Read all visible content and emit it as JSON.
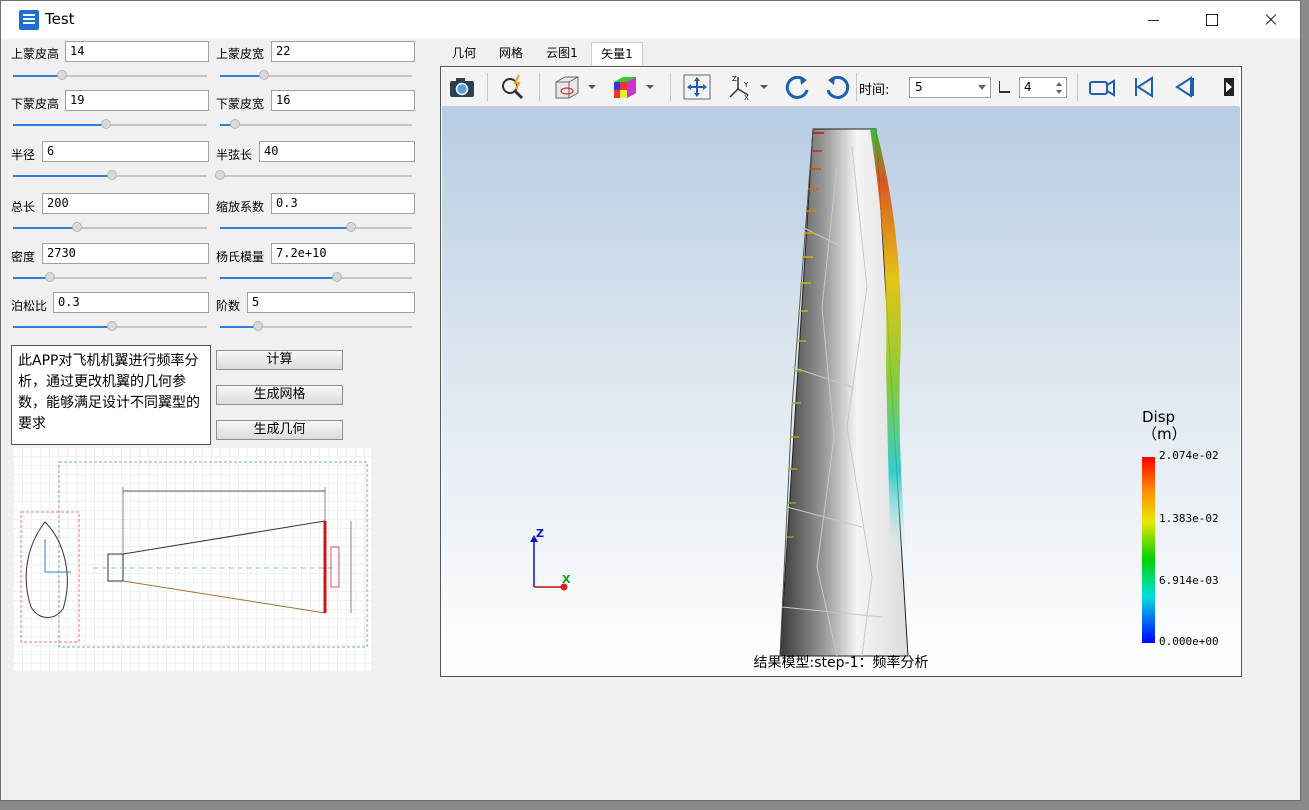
{
  "window": {
    "title": "Test"
  },
  "params": [
    {
      "label": "上蒙皮高",
      "value": "14",
      "slider": 0.25
    },
    {
      "label": "上蒙皮宽",
      "value": "22",
      "slider": 0.23
    },
    {
      "label": "下蒙皮高",
      "value": "19",
      "slider": 0.48
    },
    {
      "label": "下蒙皮宽",
      "value": "16",
      "slider": 0.08
    },
    {
      "label": "半径",
      "value": "6",
      "slider": 0.51
    },
    {
      "label": "半弦长",
      "value": "40",
      "slider": 0.0
    },
    {
      "label": "总长",
      "value": "200",
      "slider": 0.33
    },
    {
      "label": "缩放系数",
      "value": "0.3",
      "slider": 0.68
    },
    {
      "label": "密度",
      "value": "2730",
      "slider": 0.19
    },
    {
      "label": "杨氏模量",
      "value": "7.2e+10",
      "slider": 0.61
    },
    {
      "label": "泊松比",
      "value": "0.3",
      "slider": 0.51
    },
    {
      "label": "阶数",
      "value": "5",
      "slider": 0.2
    }
  ],
  "description": "此APP对飞机机翼进行频率分析，通过更改机翼的几何参数，能够满足设计不同翼型的要求",
  "buttons": {
    "compute": "计算",
    "mesh": "生成网格",
    "geometry": "生成几何"
  },
  "tabs": [
    {
      "label": "几何",
      "active": false
    },
    {
      "label": "网格",
      "active": false
    },
    {
      "label": "云图1",
      "active": false
    },
    {
      "label": "矢量1",
      "active": true
    }
  ],
  "toolbar": {
    "icons": [
      "camera-icon",
      "zoom-icon",
      "view-cube-icon",
      "color-cube-icon",
      "fit-view-icon",
      "axes-icon",
      "rotate-cw-icon",
      "rotate-ccw-icon",
      "record-video-icon",
      "first-frame-icon",
      "previous-frame-icon",
      "next-icon"
    ],
    "time_label": "时间:",
    "time_value": "5",
    "frame_value": "4"
  },
  "legend": {
    "title_line1": "Disp",
    "title_line2": "（m）",
    "ticks": [
      "2.074e-02",
      "1.383e-02",
      "6.914e-03",
      "0.000e+00"
    ]
  },
  "caption": "结果模型:step-1：频率分析",
  "axes": {
    "z": "Z",
    "x": "X",
    "y": "Y"
  },
  "colors": {
    "accent": "#2f7fd6",
    "wing_edge": "#c8161d"
  }
}
